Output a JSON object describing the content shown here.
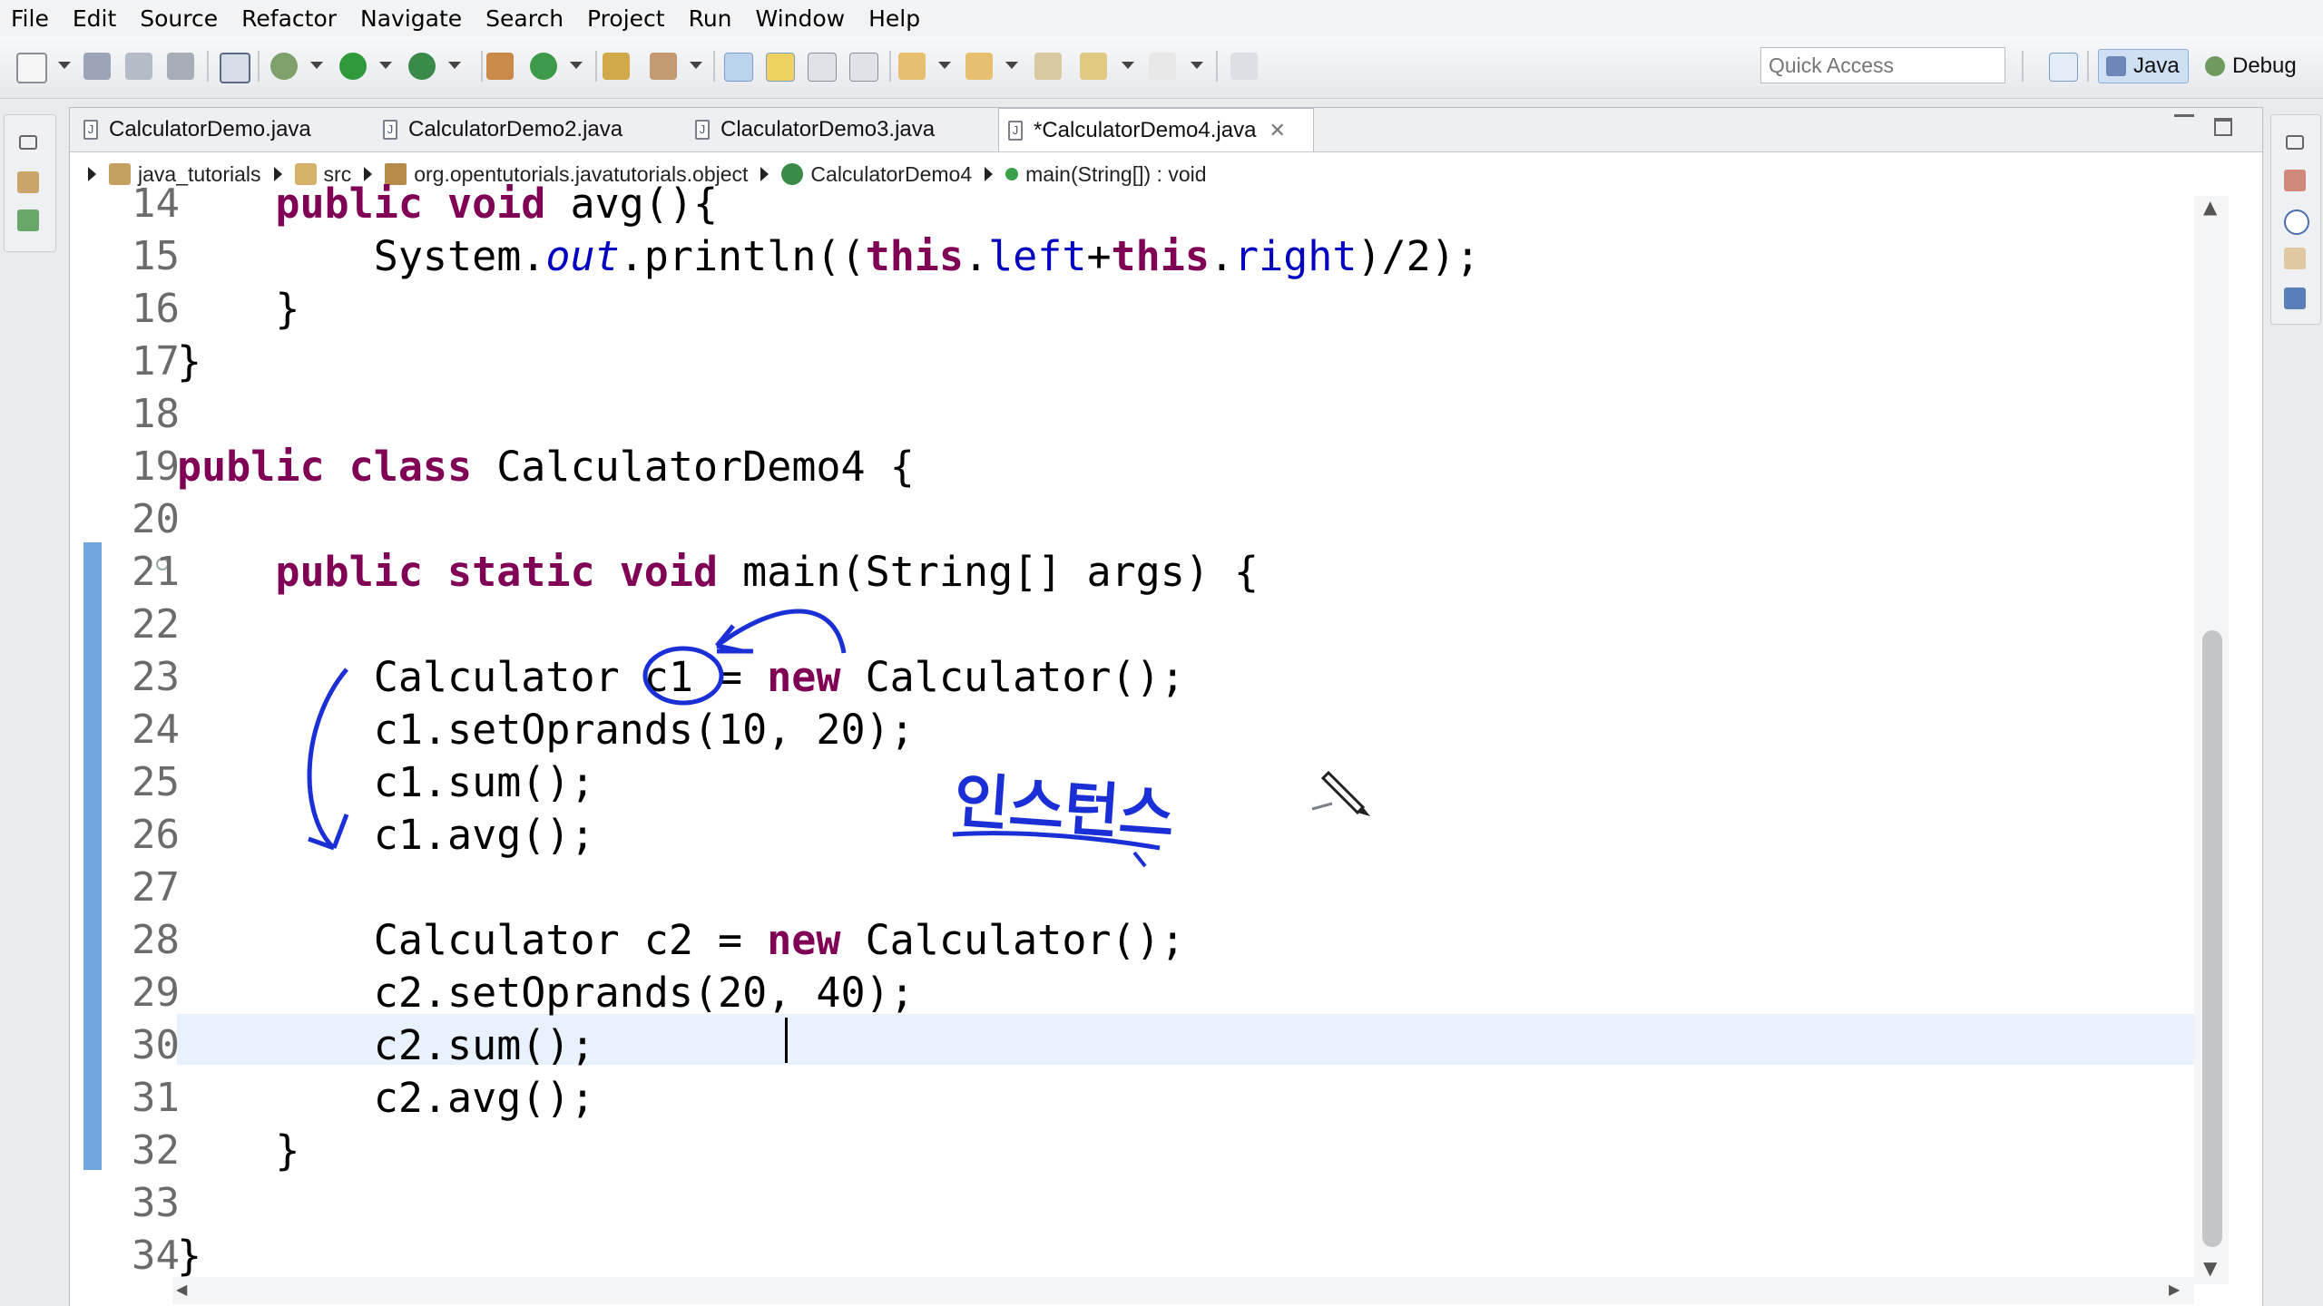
{
  "menu": [
    "File",
    "Edit",
    "Source",
    "Refactor",
    "Navigate",
    "Search",
    "Project",
    "Run",
    "Window",
    "Help"
  ],
  "quick_access": {
    "placeholder": "Quick Access"
  },
  "perspectives": {
    "java": "Java",
    "debug": "Debug"
  },
  "tabs": [
    {
      "label": "CalculatorDemo.java",
      "active": false
    },
    {
      "label": "CalculatorDemo2.java",
      "active": false
    },
    {
      "label": "ClaculatorDemo3.java",
      "active": false
    },
    {
      "label": "*CalculatorDemo4.java",
      "active": true
    }
  ],
  "breadcrumb": [
    "java_tutorials",
    "src",
    "org.opentutorials.javatutorials.object",
    "CalculatorDemo4",
    "main(String[]) : void"
  ],
  "line_numbers": [
    "14",
    "15",
    "16",
    "17",
    "18",
    "19",
    "20",
    "21",
    "22",
    "23",
    "24",
    "25",
    "26",
    "27",
    "28",
    "29",
    "30",
    "31",
    "32",
    "33",
    "34"
  ],
  "annotation_text": "인스턴스",
  "colors": {
    "keyword": "#7f0055",
    "field": "#0000c0",
    "annotation": "#1a2fd6",
    "change_bar": "#6fa7e0",
    "current_line": "#e8f2fe"
  },
  "icons": [
    "new-icon",
    "save-icon",
    "save-all-icon",
    "print-icon",
    "debug-icon",
    "run-icon",
    "coverage-icon",
    "new-java-project-icon",
    "new-class-icon",
    "open-type-icon",
    "search-icon",
    "mark-occurrences-icon",
    "toggle-block-icon",
    "show-whitespace-icon",
    "next-annotation-icon",
    "prev-annotation-icon",
    "back-icon",
    "forward-icon",
    "pin-icon",
    "open-perspective-icon"
  ]
}
